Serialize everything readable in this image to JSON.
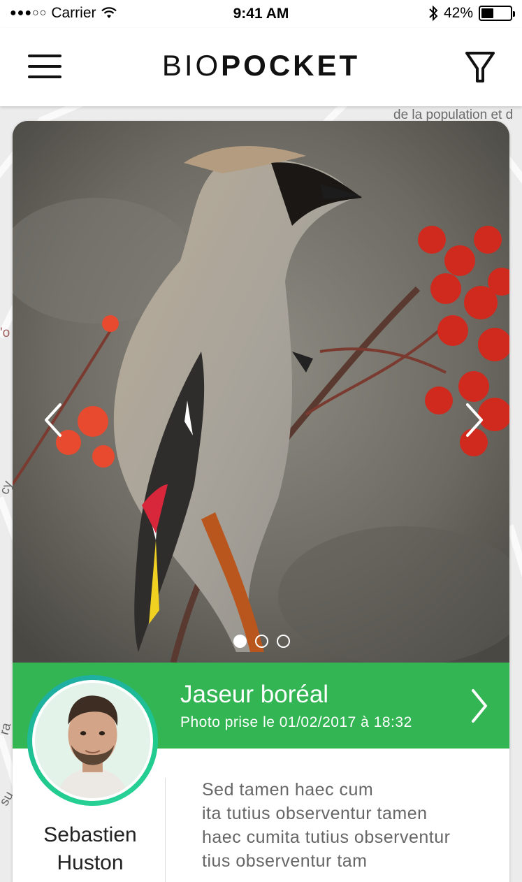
{
  "status_bar": {
    "signal": "●●●○○",
    "carrier": "Carrier",
    "time": "9:41 AM",
    "battery_percent": "42%",
    "battery_level": 0.42
  },
  "nav": {
    "logo_light": "BIO",
    "logo_bold": "POCKET"
  },
  "map": {
    "labels": [
      "de la population et d",
      "'o",
      "cy",
      "ra",
      "su"
    ]
  },
  "observation": {
    "species": "Jaseur boréal",
    "photo_date": "Photo prise le 01/02/2017 à 18:32",
    "photo_count": 3,
    "active_photo_index": 0
  },
  "author": {
    "first_name": "Sebastien",
    "last_name": "Huston"
  },
  "description": {
    "lines": [
      "Sed tamen haec cum",
      "ita tutius observentur tamen",
      "haec cumita tutius observentur",
      "tius observentur tam"
    ]
  },
  "colors": {
    "accent_green": "#33b554",
    "ring_gradient_start": "#1ea7a8",
    "ring_gradient_end": "#2ad39a"
  }
}
